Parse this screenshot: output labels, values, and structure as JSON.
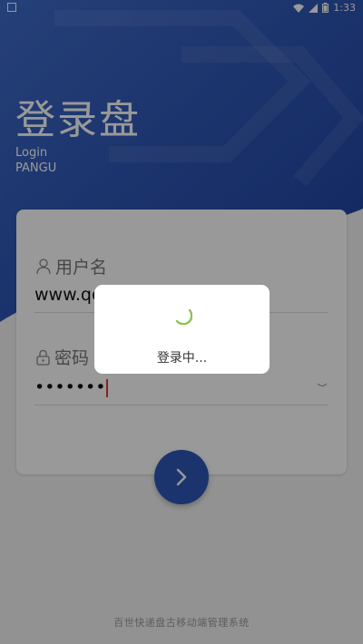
{
  "status_bar": {
    "time": "1:33",
    "icons": [
      "notification-icon",
      "wifi-icon",
      "signal-icon",
      "battery-icon"
    ]
  },
  "header": {
    "title": "登录盘",
    "subtitle_line1": "Login",
    "subtitle_line2": "PANGU"
  },
  "form": {
    "username_label": "用户名",
    "username_value": "www.qc",
    "password_label": "密码",
    "password_value": "•••••••"
  },
  "dialog": {
    "text": "登录中..."
  },
  "footer": {
    "text": "百世快递盘古移动端管理系统"
  },
  "colors": {
    "brand_blue": "#2b55b5",
    "spinner_green": "#8bc34a",
    "cursor_red": "#e53935"
  }
}
